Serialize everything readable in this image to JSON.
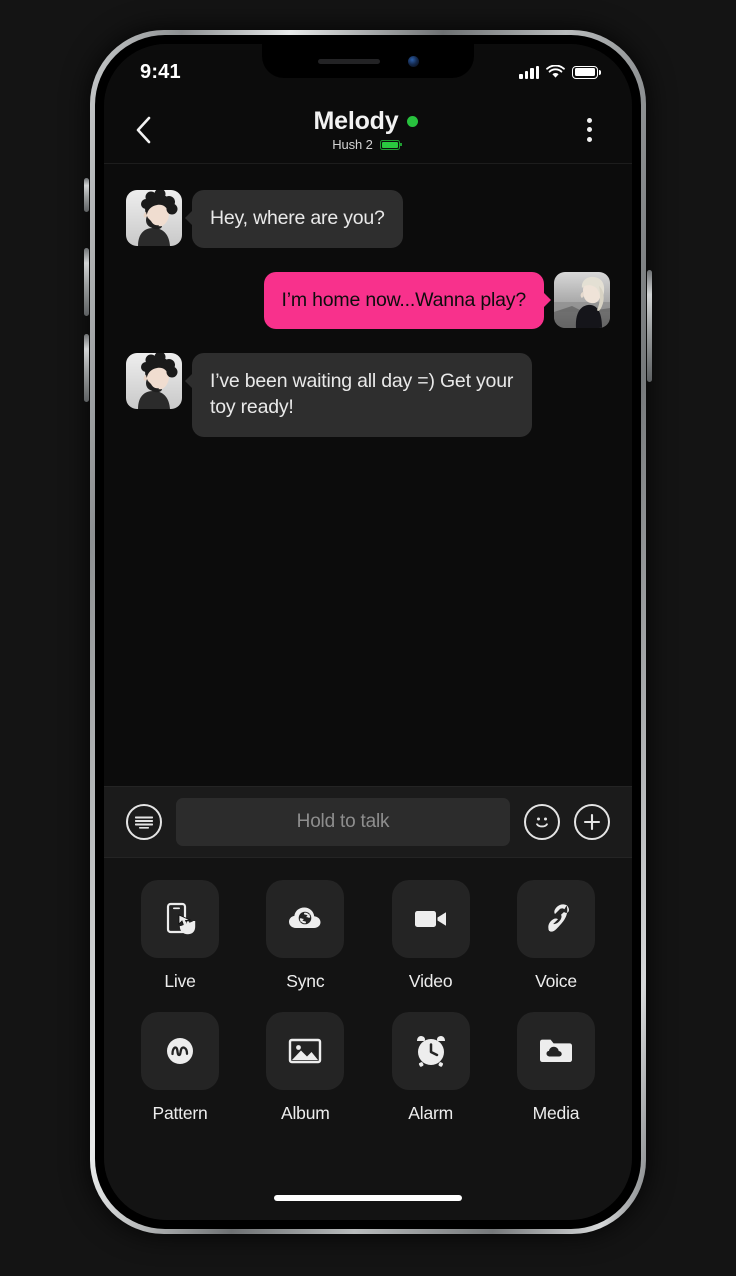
{
  "status_bar": {
    "time": "9:41",
    "signal_icon": "cellular-signal-icon",
    "wifi_icon": "wifi-icon",
    "battery_icon": "battery-icon"
  },
  "header": {
    "back_icon": "chevron-left-icon",
    "title": "Melody",
    "online_status": "online",
    "online_color": "#28c23e",
    "device_name": "Hush 2",
    "device_battery_icon": "device-battery-icon",
    "device_battery_color": "#2ac940",
    "menu_icon": "more-vertical-icon"
  },
  "conversation": {
    "messages": [
      {
        "id": "msg-1",
        "direction": "incoming",
        "text": "Hey, where are you?",
        "avatar": "contact-avatar-male",
        "bubble_color": "#2e2e2e",
        "text_color": "#e9e9e9"
      },
      {
        "id": "msg-2",
        "direction": "outgoing",
        "text": "I’m home now...Wanna play?",
        "avatar": "user-avatar-female",
        "bubble_color": "#f8318c",
        "text_color": "#0d0d0d"
      },
      {
        "id": "msg-3",
        "direction": "incoming",
        "text": "I’ve been waiting all day =) Get your toy ready!",
        "avatar": "contact-avatar-male",
        "bubble_color": "#2e2e2e",
        "text_color": "#e9e9e9"
      }
    ]
  },
  "input_bar": {
    "keyboard_icon": "keyboard-icon",
    "hold_to_talk_label": "Hold to talk",
    "emoji_icon": "smiley-icon",
    "add_icon": "plus-icon"
  },
  "actions": {
    "row1": [
      {
        "label": "Live",
        "icon": "phone-tap-icon"
      },
      {
        "label": "Sync",
        "icon": "cloud-sync-icon"
      },
      {
        "label": "Video",
        "icon": "video-camera-icon"
      },
      {
        "label": "Voice",
        "icon": "phone-handset-icon"
      }
    ],
    "row2": [
      {
        "label": "Pattern",
        "icon": "wave-pattern-icon"
      },
      {
        "label": "Album",
        "icon": "image-icon"
      },
      {
        "label": "Alarm",
        "icon": "alarm-clock-icon"
      },
      {
        "label": "Media",
        "icon": "folder-cloud-icon"
      }
    ]
  },
  "home_indicator": "home-indicator-bar"
}
